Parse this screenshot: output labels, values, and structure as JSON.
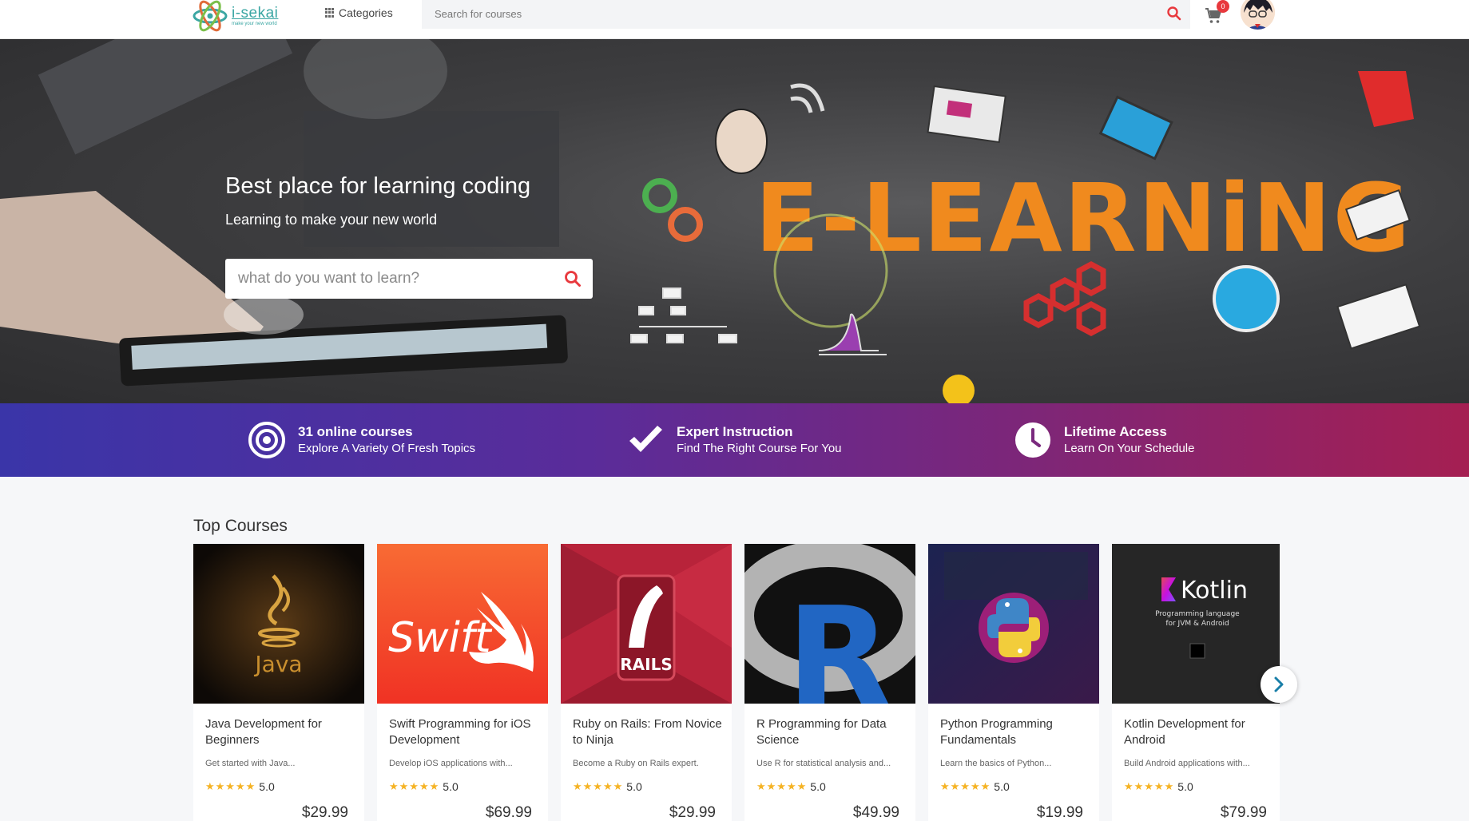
{
  "header": {
    "logo_name": "i-sekai",
    "logo_tagline": "make your new world",
    "categories_label": "Categories",
    "search_placeholder": "Search for courses",
    "cart_count": "0"
  },
  "hero": {
    "title": "Best place for learning coding",
    "subtitle": "Learning to make your new world",
    "search_placeholder": "what do you want to learn?",
    "banner_text": "E-LEARNiNG"
  },
  "features": [
    {
      "title": "31 online courses",
      "subtitle": "Explore A Variety Of Fresh Topics",
      "icon": "target-icon"
    },
    {
      "title": "Expert Instruction",
      "subtitle": "Find The Right Course For You",
      "icon": "checkmark-icon"
    },
    {
      "title": "Lifetime Access",
      "subtitle": "Learn On Your Schedule",
      "icon": "clock-icon"
    }
  ],
  "top_courses": {
    "heading": "Top Courses",
    "courses": [
      {
        "title": "Java Development for Beginners",
        "description": "Get started with Java...",
        "rating": "5.0",
        "price": "$29.99",
        "thumb_label": "Java"
      },
      {
        "title": "Swift Programming for iOS Development",
        "description": "Develop iOS applications with...",
        "rating": "5.0",
        "price": "$69.99",
        "thumb_label": "Swift"
      },
      {
        "title": "Ruby on Rails: From Novice to Ninja",
        "description": "Become a Ruby on Rails expert.",
        "rating": "5.0",
        "price": "$29.99",
        "thumb_label": "RAILS"
      },
      {
        "title": "R Programming for Data Science",
        "description": "Use R for statistical analysis and...",
        "rating": "5.0",
        "price": "$49.99",
        "thumb_label": "R"
      },
      {
        "title": "Python Programming Fundamentals",
        "description": "Learn the basics of Python...",
        "rating": "5.0",
        "price": "$19.99",
        "thumb_label": "Python"
      },
      {
        "title": "Kotlin Development for Android",
        "description": "Build Android applications with...",
        "rating": "5.0",
        "price": "$79.99",
        "thumb_label": "Kotlin",
        "thumb_sub1": "Programming language",
        "thumb_sub2": "for JVM & Android"
      }
    ]
  },
  "colors": {
    "accent_red": "#e8383d",
    "star": "#f5b324",
    "band_start": "#3a35a8",
    "band_end": "#a51f52"
  }
}
